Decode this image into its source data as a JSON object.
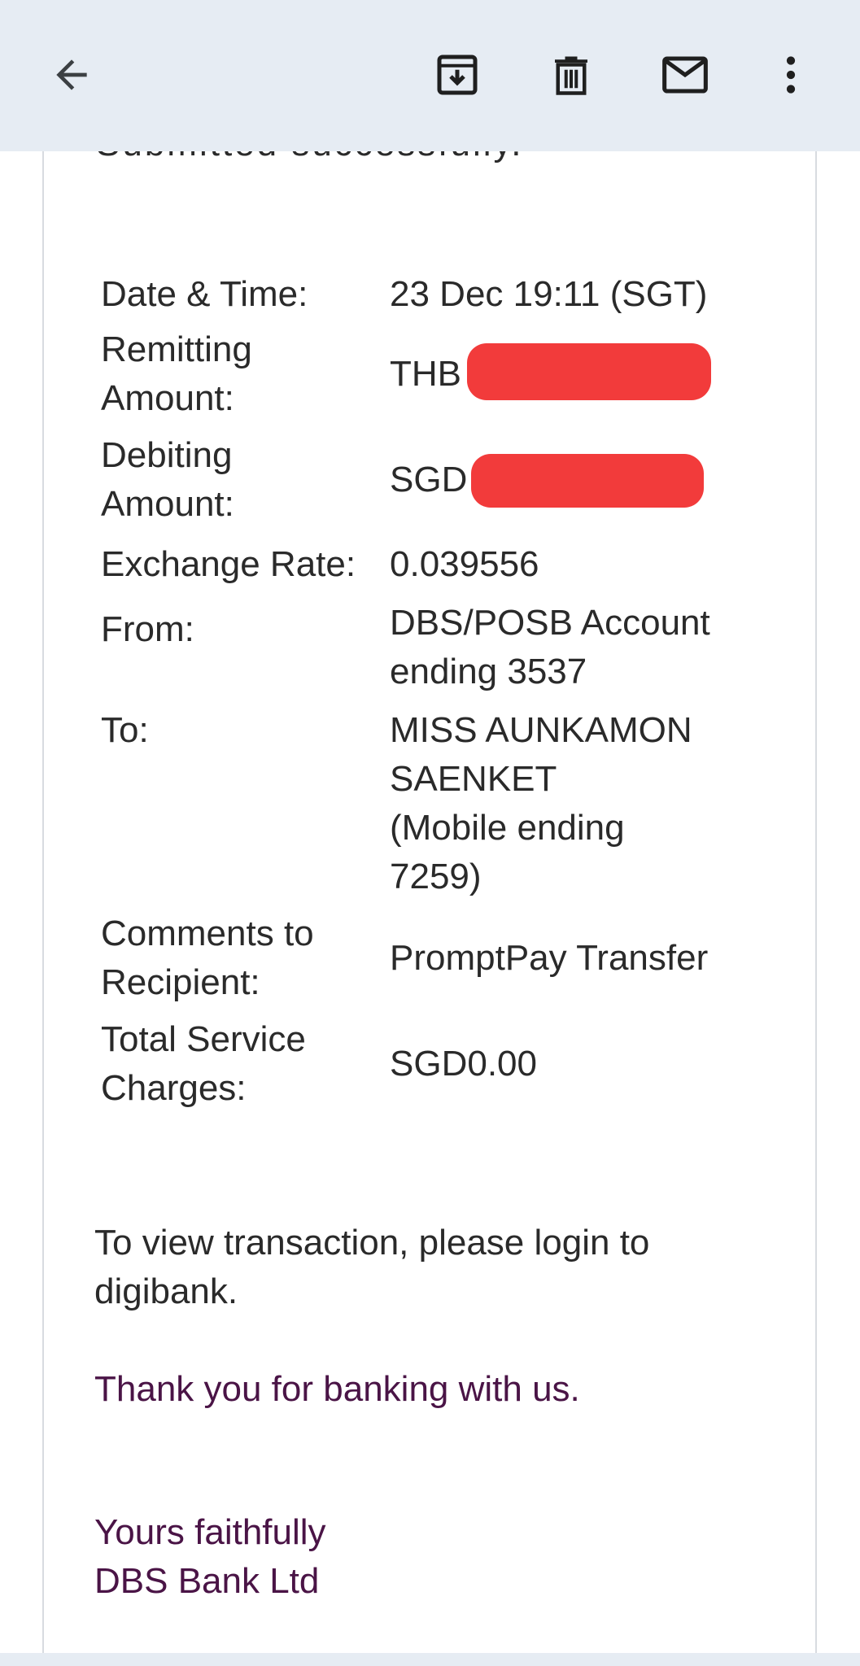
{
  "toolbar": {
    "back_icon": "arrow-left-icon",
    "archive_icon": "archive-icon",
    "delete_icon": "trash-icon",
    "mark_unread_icon": "mail-icon",
    "more_icon": "more-vert-icon"
  },
  "email": {
    "cut_line": "Submitted successfully.",
    "details": {
      "date_time_label": "Date & Time:",
      "date_time_value": "23 Dec 19:11 (SGT)",
      "remitting_label_1": "Remitting",
      "remitting_label_2": "Amount:",
      "remitting_currency": "THB",
      "debiting_label_1": "Debiting",
      "debiting_label_2": "Amount:",
      "debiting_currency": "SGD",
      "exchange_label": "Exchange Rate:",
      "exchange_value": "0.039556",
      "from_label": "From:",
      "from_value_1": "DBS/POSB Account",
      "from_value_2": "ending 3537",
      "to_label": "To:",
      "to_value_1": "MISS AUNKAMON",
      "to_value_2": "SAENKET",
      "to_value_3": "(Mobile ending",
      "to_value_4": "7259)",
      "comments_label_1": "Comments to",
      "comments_label_2": "Recipient:",
      "comments_value": "PromptPay Transfer",
      "charges_label_1": "Total Service",
      "charges_label_2": "Charges:",
      "charges_value": "SGD0.00"
    },
    "view_line_1": "To view transaction, please login to",
    "view_line_2": "digibank.",
    "thanks": "Thank you for banking with us.",
    "signoff_1": "Yours faithfully",
    "signoff_2": "DBS Bank Ltd"
  },
  "colors": {
    "toolbar_bg": "#e6ecf3",
    "text": "#2a2a2a",
    "brand_purple": "#4a1446",
    "redaction": "#f23b3b"
  }
}
